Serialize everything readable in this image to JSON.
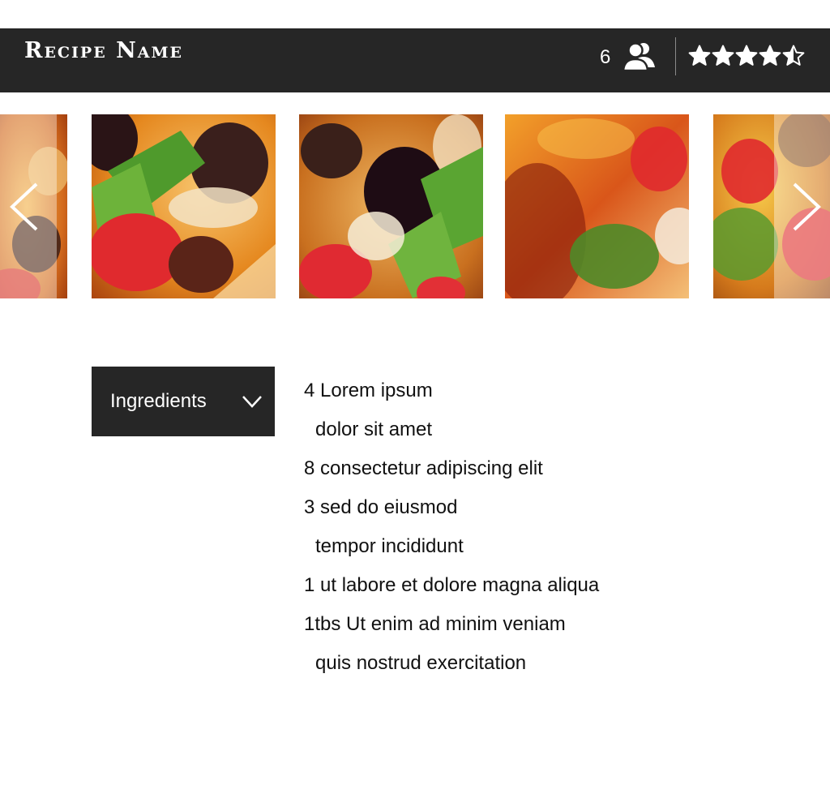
{
  "header": {
    "title": "Recipe Name",
    "servings": "6",
    "servings_icon": "people-icon",
    "rating": 4.5,
    "rating_max": 5
  },
  "gallery": {
    "prev_icon": "chevron-left-icon",
    "next_icon": "chevron-right-icon",
    "photo_count": 5
  },
  "section_select": {
    "label": "Ingredients",
    "icon": "chevron-down-icon"
  },
  "ingredients": [
    {
      "text": "4 Lorem ipsum",
      "continuation": false
    },
    {
      "text": "dolor sit amet",
      "continuation": true
    },
    {
      "text": "8 consectetur adipiscing elit",
      "continuation": false
    },
    {
      "text": "3 sed do eiusmod",
      "continuation": false
    },
    {
      "text": "tempor incididunt",
      "continuation": true
    },
    {
      "text": "1 ut labore et dolore magna aliqua",
      "continuation": false
    },
    {
      "text": "1tbs Ut enim ad minim veniam",
      "continuation": false
    },
    {
      "text": "quis nostrud exercitation",
      "continuation": true
    }
  ],
  "colors": {
    "header_bg": "#262626",
    "text": "#111111",
    "on_dark": "#ffffff"
  }
}
